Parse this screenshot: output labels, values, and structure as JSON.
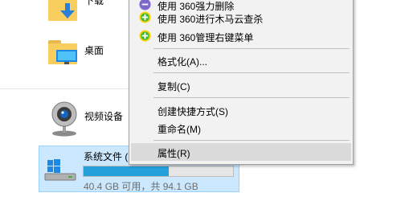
{
  "explorer": {
    "items": [
      {
        "label": "下载"
      },
      {
        "label": "桌面"
      },
      {
        "label": "视频设备"
      }
    ],
    "drive": {
      "label": "系统文件 (",
      "space_text": "40.4 GB 可用，共 94.1 GB",
      "used_fraction": 0.57
    }
  },
  "context_menu": {
    "items": [
      {
        "label": "使用 360强力删除",
        "icon": "360-icon"
      },
      {
        "label": "使用 360进行木马云查杀",
        "icon": "360-icon"
      },
      {
        "label": "使用 360管理右键菜单",
        "icon": "360-icon"
      },
      {
        "label": "格式化(A)..."
      },
      {
        "label": "复制(C)"
      },
      {
        "label": "创建快捷方式(S)"
      },
      {
        "label": "重命名(M)"
      },
      {
        "label": "属性(R)"
      }
    ]
  },
  "colors": {
    "selection": "#cce8ff",
    "selection_border": "#99d1ff",
    "drive_bar_fill": "#26a0da",
    "menu_background": "#f2f2f2",
    "menu_hover": "#dadada",
    "icon_360_green": "#3cb62f",
    "icon_360_yellow": "#f5d20a"
  }
}
